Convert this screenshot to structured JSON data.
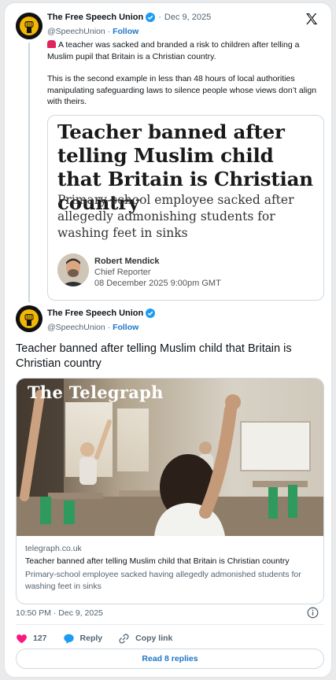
{
  "colors": {
    "accent": "#1d75c9",
    "like": "#f91880",
    "verified": "#1d9bf0",
    "muted": "#536471"
  },
  "tweet1": {
    "account_name": "The Free Speech Union",
    "separator": "·",
    "date": "Dec 9, 2025",
    "handle": "@SpeechUnion",
    "follow_label": "Follow",
    "paragraph1": "A teacher was sacked and branded a risk to children after telling a Muslim pupil that Britain is a Christian country.",
    "paragraph2": "This is the second example in less than 48 hours of local authorities manipulating safeguarding laws to silence people whose views don’t align with theirs.",
    "icon": "rotating-light-emoji"
  },
  "quote_image": {
    "headline": "Teacher banned after telling Muslim child that Britain is Christian country",
    "subheadline": "Primary-school employee sacked after allegedly admonishing students for washing feet in sinks",
    "author_name": "Robert Mendick",
    "author_role": "Chief Reporter",
    "published": "08 December 2025 9:00pm GMT"
  },
  "tweet2": {
    "account_name": "The Free Speech Union",
    "handle": "@SpeechUnion",
    "follow_label": "Follow",
    "text": "Teacher banned after telling Muslim child that Britain is Christian country",
    "link_card": {
      "image_logo": "The Telegraph",
      "domain": "telegraph.co.uk",
      "title": "Teacher banned after telling Muslim child that Britain is Christian country",
      "description": "Primary-school employee sacked having allegedly admonished students for washing feet in sinks"
    },
    "timestamp": "10:50 PM · Dec 9, 2025",
    "likes": "127",
    "reply_label": "Reply",
    "copy_link_label": "Copy link",
    "read_replies_label": "Read 8 replies"
  },
  "icons": [
    "fist-logo-icon",
    "verified-badge-icon",
    "x-logo-icon",
    "info-icon",
    "heart-icon",
    "reply-bubble-icon",
    "link-icon"
  ]
}
